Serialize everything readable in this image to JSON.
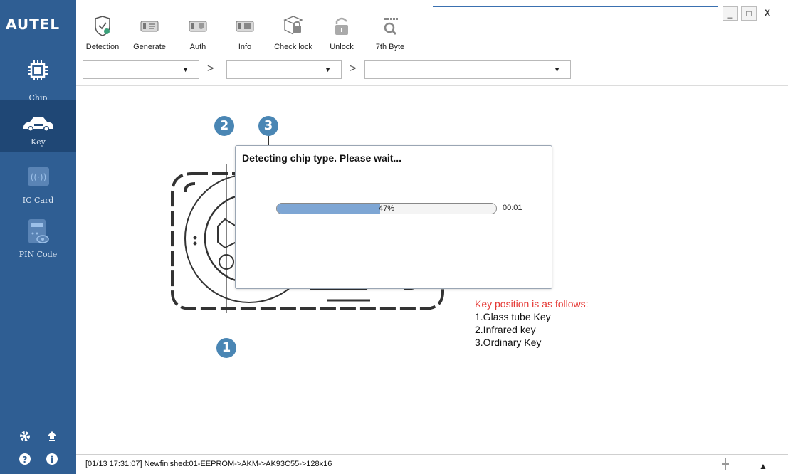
{
  "app": {
    "logo": "AUTEL"
  },
  "sidebar": {
    "items": [
      {
        "label": "Chip",
        "icon": "chip-icon"
      },
      {
        "label": "Key",
        "icon": "car-key-icon"
      },
      {
        "label": "IC Card",
        "icon": "nfc-card-icon"
      },
      {
        "label": "PIN Code",
        "icon": "pin-code-icon"
      }
    ],
    "bottom_icons": [
      "settings-icon",
      "upload-icon",
      "help-icon",
      "info-icon"
    ]
  },
  "toolbar": {
    "buttons": [
      {
        "label": "Detection",
        "icon": "shield-check-icon"
      },
      {
        "label": "Generate",
        "icon": "generate-icon"
      },
      {
        "label": "Auth",
        "icon": "auth-icon"
      },
      {
        "label": "Info",
        "icon": "info-card-icon"
      },
      {
        "label": "Check lock",
        "icon": "check-lock-icon"
      },
      {
        "label": "Unlock",
        "icon": "unlock-icon"
      },
      {
        "label": "7th Byte",
        "icon": "byte-search-icon"
      }
    ]
  },
  "path_selectors": [
    {
      "value": "",
      "arrow": "▼"
    },
    {
      "value": "",
      "arrow": "▼"
    },
    {
      "value": "",
      "arrow": "▼"
    }
  ],
  "path_separator": ">",
  "window_controls": {
    "minimize": "_",
    "maximize": "□",
    "close": "X"
  },
  "dialog": {
    "title": "Detecting chip type. Please wait...",
    "progress_percent": 47,
    "progress_label": "47%",
    "elapsed": "00:01"
  },
  "markers": [
    "1",
    "2",
    "3"
  ],
  "legend": {
    "heading": "Key position is as follows:",
    "items": [
      "1.Glass tube Key",
      "2.Infrared key",
      "3.Ordinary Key"
    ],
    "heading_color": "#e53935"
  },
  "status": {
    "log": "[01/13 17:31:07] Newfinished:01-EEPROM->AKM->AK93C55->128x16",
    "collapse_arrow": "▲"
  },
  "colors": {
    "sidebar": "#2f5e93",
    "sidebar_active": "#1f4775",
    "progress": "#7ea6d4",
    "badge": "#4a86b4"
  }
}
